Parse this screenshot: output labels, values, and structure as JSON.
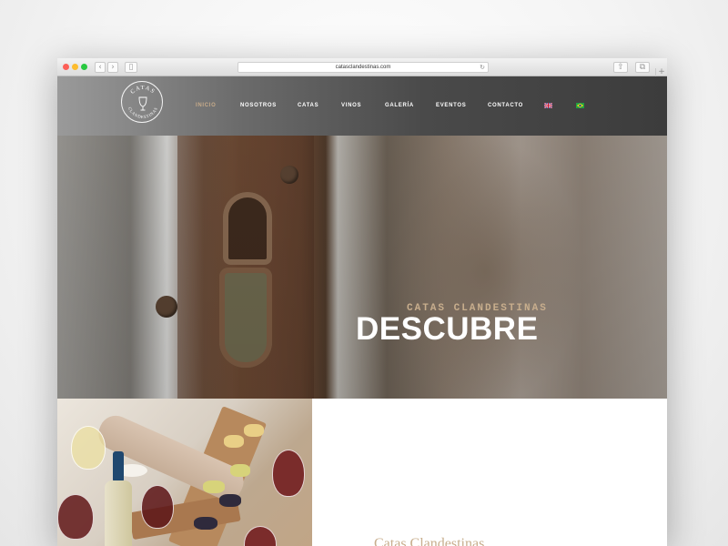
{
  "browser": {
    "url": "catasclandestinas.com",
    "back_glyph": "‹",
    "forward_glyph": "›",
    "sidebar_glyph": "▯",
    "reload_glyph": "↻",
    "share_glyph": "⇧",
    "tabs_glyph": "⧉",
    "newtab_glyph": "+"
  },
  "header": {
    "logo_alt": "Catas Clandestinas",
    "nav": [
      {
        "label": "INICIO",
        "active": true
      },
      {
        "label": "NOSOTROS",
        "active": false
      },
      {
        "label": "CATAS",
        "active": false
      },
      {
        "label": "VINOS",
        "active": false
      },
      {
        "label": "GALERÍA",
        "active": false
      },
      {
        "label": "EVENTOS",
        "active": false
      },
      {
        "label": "CONTACTO",
        "active": false
      }
    ],
    "languages": [
      "uk-flag-icon",
      "brazil-flag-icon"
    ]
  },
  "hero": {
    "subtitle": "CATAS CLANDESTINAS",
    "title": "DESCUBRE"
  },
  "content": {
    "title": "Catas Clandestinas"
  },
  "colors": {
    "accent": "#c7ab8a",
    "header_dark": "#3c3c3c"
  }
}
